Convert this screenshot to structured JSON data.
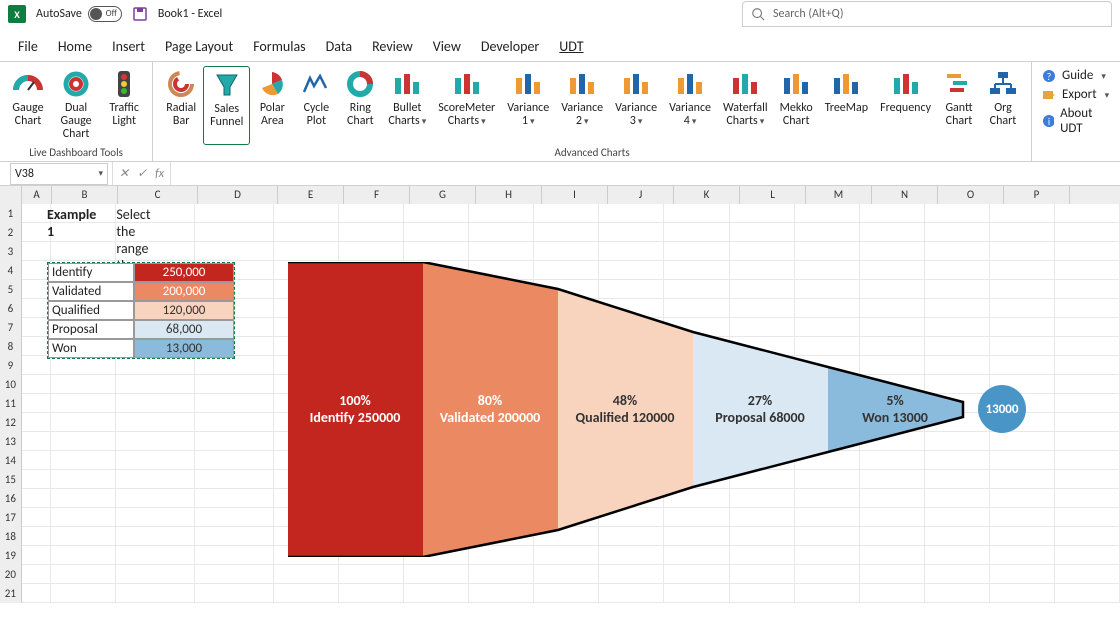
{
  "titlebar": {
    "autosave_label": "AutoSave",
    "autosave_state": "Off",
    "book_title": "Book1 - Excel",
    "search_placeholder": "Search (Alt+Q)"
  },
  "menu_tabs": [
    "File",
    "Home",
    "Insert",
    "Page Layout",
    "Formulas",
    "Data",
    "Review",
    "View",
    "Developer",
    "UDT"
  ],
  "menu_active": "UDT",
  "ribbon": {
    "group1_label": "Live Dashboard Tools",
    "group1_items": [
      "Gauge Chart",
      "Dual Gauge Chart",
      "Traffic Light"
    ],
    "group2_label": "Advanced Charts",
    "group2_items": [
      "Radial Bar",
      "Sales Funnel",
      "Polar Area",
      "Cycle Plot",
      "Ring Chart",
      "Bullet Charts",
      "ScoreMeter Charts",
      "Variance 1",
      "Variance 2",
      "Variance 3",
      "Variance 4",
      "Waterfall Charts",
      "Mekko Chart",
      "TreeMap",
      "Frequency",
      "Gantt Chart",
      "Org Chart"
    ],
    "group2_active": "Sales Funnel",
    "right_items": {
      "guide": "Guide",
      "export": "Export",
      "about": "About UDT"
    }
  },
  "namebox": "V38",
  "columns": [
    "",
    "A",
    "B",
    "C",
    "D",
    "E",
    "F",
    "G",
    "H",
    "I",
    "J",
    "K",
    "L",
    "M",
    "N",
    "O",
    "P"
  ],
  "row_count": 21,
  "example": {
    "title": "Example 1",
    "subtitle": "Select the range then click on the Sales Funnel icon"
  },
  "data_table": {
    "rows": [
      {
        "label": "Identify",
        "value": "250,000",
        "bg": "#c3261e",
        "fg": "#fff"
      },
      {
        "label": "Validated",
        "value": "200,000",
        "bg": "#eb8a62",
        "fg": "#fff"
      },
      {
        "label": "Qualified",
        "value": "120,000",
        "bg": "#f8d4bf",
        "fg": "#333"
      },
      {
        "label": "Proposal",
        "value": "68,000",
        "bg": "#d9e8f3",
        "fg": "#333"
      },
      {
        "label": "Won",
        "value": "13,000",
        "bg": "#8abbdc",
        "fg": "#333"
      }
    ]
  },
  "chart_data": {
    "type": "funnel",
    "stages": [
      {
        "name": "Identify",
        "value": 250000,
        "pct": 100,
        "color": "#c3261e"
      },
      {
        "name": "Validated",
        "value": 200000,
        "pct": 80,
        "color": "#eb8a62"
      },
      {
        "name": "Qualified",
        "value": 120000,
        "pct": 48,
        "color": "#f8d4bf"
      },
      {
        "name": "Proposal",
        "value": 68000,
        "pct": 27,
        "color": "#d9e8f3"
      },
      {
        "name": "Won",
        "value": 13000,
        "pct": 5,
        "color": "#8abbdc"
      }
    ],
    "end_label": "13000",
    "labels": [
      {
        "line1": "100%",
        "line2": "Identify 250000",
        "dark": false
      },
      {
        "line1": "80%",
        "line2": "Validated 200000",
        "dark": false
      },
      {
        "line1": "48%",
        "line2": "Qualified 120000",
        "dark": true
      },
      {
        "line1": "27%",
        "line2": "Proposal 68000",
        "dark": true
      },
      {
        "line1": "5%",
        "line2": "Won 13000",
        "dark": true
      }
    ]
  }
}
